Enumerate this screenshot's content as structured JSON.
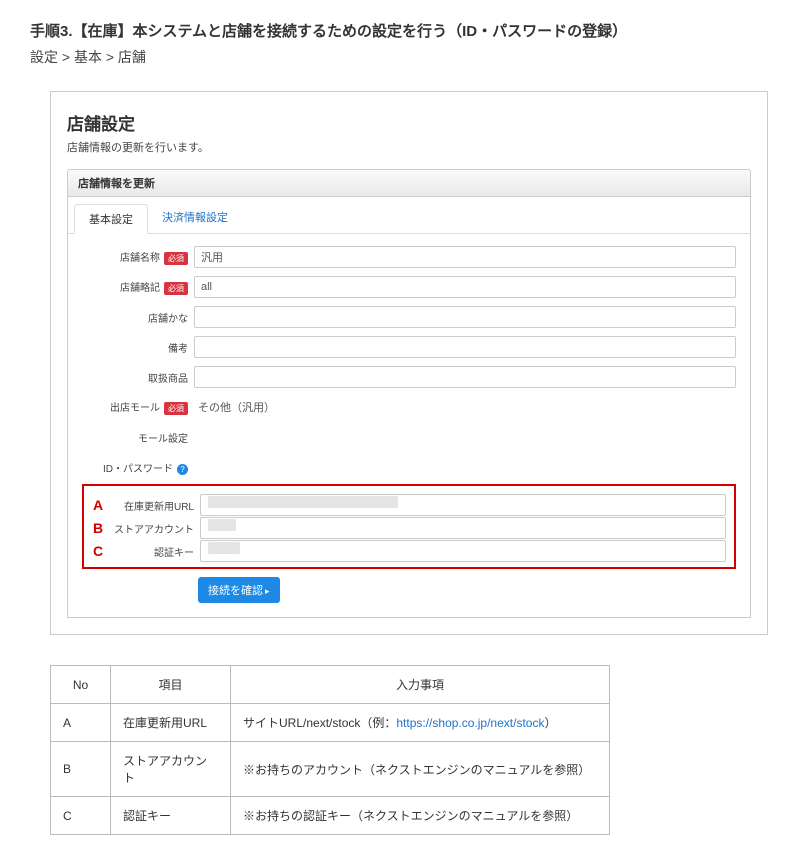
{
  "step_title": "手順3.【在庫】本システムと店舗を接続するための設定を行う（ID・パスワードの登録）",
  "breadcrumb": "設定 > 基本 > 店舗",
  "panel": {
    "title": "店舗設定",
    "desc": "店舗情報の更新を行います。",
    "section_header": "店舗情報を更新",
    "tabs": {
      "basic": "基本設定",
      "payment": "決済情報設定"
    },
    "required_badge": "必須",
    "labels": {
      "shop_name": "店舗名称",
      "shop_abbr": "店舗略記",
      "shop_kana": "店舗かな",
      "note": "備考",
      "handle_item": "取扱商品",
      "mall": "出店モール",
      "mall_setting": "モール設定",
      "id_password": "ID・パスワード",
      "stock_url": "在庫更新用URL",
      "store_account": "ストアアカウント",
      "auth_key": "認証キー"
    },
    "values": {
      "shop_name": "汎用",
      "shop_abbr": "all",
      "mall": "その他（汎用）"
    },
    "markers": {
      "A": "A",
      "B": "B",
      "C": "C"
    },
    "confirm_btn": "接続を確認"
  },
  "ref_table": {
    "headers": {
      "no": "No",
      "item": "項目",
      "input": "入力事項"
    },
    "rows": [
      {
        "no": "A",
        "item": "在庫更新用URL",
        "text_pre": "サイトURL/next/stock（例：",
        "link": "https://shop.co.jp/next/stock",
        "text_post": "）"
      },
      {
        "no": "B",
        "item": "ストアアカウント",
        "text": "※お持ちのアカウント（ネクストエンジンのマニュアルを参照）"
      },
      {
        "no": "C",
        "item": "認証キー",
        "text": "※お持ちの認証キー（ネクストエンジンのマニュアルを参照）"
      }
    ]
  }
}
